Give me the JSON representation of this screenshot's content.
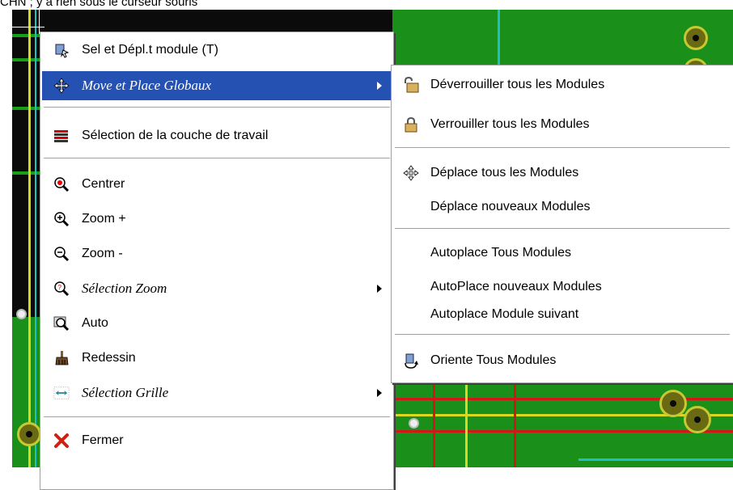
{
  "caption": "CHN ; y a rien sous le curseur souris",
  "main_menu": {
    "items": [
      {
        "icon": "move-module-icon",
        "label": "Sel et Dépl.t module (T)"
      },
      {
        "icon": "move-arrows-icon",
        "label": "Move et Place Globaux"
      },
      {
        "icon": "layers-icon",
        "label": "Sélection de la couche de travail"
      },
      {
        "icon": "center-zoom-icon",
        "label": "Centrer"
      },
      {
        "icon": "zoom-in-icon",
        "label": "Zoom +"
      },
      {
        "icon": "zoom-out-icon",
        "label": "Zoom -"
      },
      {
        "icon": "zoom-select-icon",
        "label": "Sélection Zoom"
      },
      {
        "icon": "zoom-auto-icon",
        "label": "Auto"
      },
      {
        "icon": "redraw-brush-icon",
        "label": "Redessin"
      },
      {
        "icon": "grid-icon",
        "label": "Sélection Grille"
      },
      {
        "icon": "close-x-icon",
        "label": "Fermer"
      }
    ]
  },
  "sub_menu": {
    "items": [
      {
        "icon": "unlock-icon",
        "label": "Déverrouiller tous les Modules"
      },
      {
        "icon": "lock-icon",
        "label": "Verrouiller tous les Modules"
      },
      {
        "icon": "move-arrows-icon",
        "label": "Déplace tous les Modules"
      },
      {
        "icon": "",
        "label": "Déplace nouveaux Modules"
      },
      {
        "icon": "",
        "label": "Autoplace Tous Modules"
      },
      {
        "icon": "",
        "label": "AutoPlace nouveaux Modules"
      },
      {
        "icon": "",
        "label": "Autoplace Module suivant"
      },
      {
        "icon": "rotate-icon",
        "label": "Oriente Tous Modules"
      }
    ]
  },
  "colors": {
    "highlight": "#2552b2",
    "pcb_background": "#0b0b0b",
    "copper_green": "#18a018",
    "trace_red": "#d01818",
    "trace_yellow": "#d8d820",
    "trace_cyan": "#20c0c0"
  }
}
